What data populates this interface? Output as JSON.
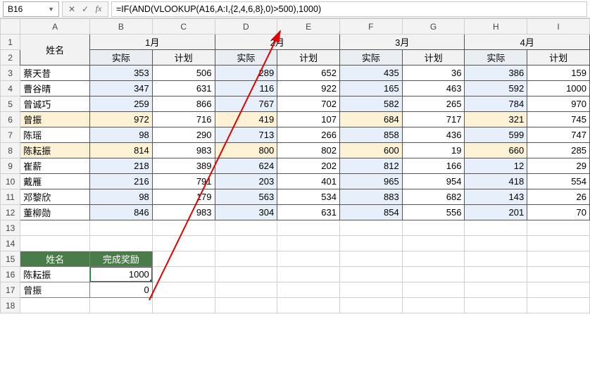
{
  "nameBox": "B16",
  "formula": "=IF(AND(VLOOKUP(A16,A:I,{2,4,6,8},0)>500),1000)",
  "colHeaders": [
    "A",
    "B",
    "C",
    "D",
    "E",
    "F",
    "G",
    "H",
    "I"
  ],
  "headerRow1": {
    "name": "姓名",
    "months": [
      "1月",
      "2月",
      "3月",
      "4月"
    ]
  },
  "headerRow2": {
    "actual": "实际",
    "plan": "计划"
  },
  "rows": [
    {
      "r": 3,
      "name": "蔡天昔",
      "hl": false,
      "vals": [
        353,
        506,
        289,
        652,
        435,
        36,
        386,
        159
      ]
    },
    {
      "r": 4,
      "name": "曹谷晴",
      "hl": false,
      "vals": [
        347,
        631,
        116,
        922,
        165,
        463,
        592,
        1000
      ]
    },
    {
      "r": 5,
      "name": "曾诚巧",
      "hl": false,
      "vals": [
        259,
        866,
        767,
        702,
        582,
        265,
        784,
        970
      ]
    },
    {
      "r": 6,
      "name": "曾振",
      "hl": true,
      "vals": [
        972,
        716,
        419,
        107,
        684,
        717,
        321,
        745
      ]
    },
    {
      "r": 7,
      "name": "陈瑶",
      "hl": false,
      "vals": [
        98,
        290,
        713,
        266,
        858,
        436,
        599,
        747
      ]
    },
    {
      "r": 8,
      "name": "陈耘振",
      "hl": true,
      "vals": [
        814,
        983,
        800,
        802,
        600,
        19,
        660,
        285
      ]
    },
    {
      "r": 9,
      "name": "崔薪",
      "hl": false,
      "vals": [
        218,
        389,
        624,
        202,
        812,
        166,
        12,
        29
      ]
    },
    {
      "r": 10,
      "name": "戴雁",
      "hl": false,
      "vals": [
        216,
        791,
        203,
        401,
        965,
        954,
        418,
        554
      ]
    },
    {
      "r": 11,
      "name": "邓黎欣",
      "hl": false,
      "vals": [
        98,
        179,
        563,
        534,
        883,
        682,
        143,
        26
      ]
    },
    {
      "r": 12,
      "name": "董柳勋",
      "hl": false,
      "vals": [
        846,
        983,
        304,
        631,
        854,
        556,
        201,
        70
      ]
    }
  ],
  "miniTable": {
    "headers": [
      "姓名",
      "完成奖励"
    ],
    "rows": [
      {
        "r": 16,
        "name": "陈耘振",
        "val": 1000
      },
      {
        "r": 17,
        "name": "曾振",
        "val": 0
      }
    ]
  },
  "blankRows": [
    13,
    14,
    18
  ]
}
